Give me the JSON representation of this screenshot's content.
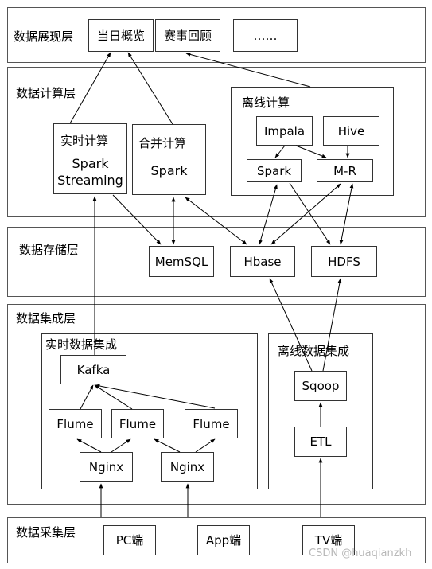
{
  "layers": {
    "presentation": {
      "label": "数据展现层",
      "items": [
        "当日概览",
        "赛事回顾",
        "……"
      ]
    },
    "compute": {
      "label": "数据计算层",
      "realtime": {
        "title": "实时计算",
        "body": [
          "Spark",
          "Streaming"
        ]
      },
      "merge": {
        "title": "合并计算",
        "body": "Spark"
      },
      "offline": {
        "title": "离线计算",
        "impala": "Impala",
        "hive": "Hive",
        "spark": "Spark",
        "mr": "M-R"
      }
    },
    "storage": {
      "label": "数据存储层",
      "items": [
        "MemSQL",
        "Hbase",
        "HDFS"
      ]
    },
    "integration": {
      "label": "数据集成层",
      "realtime": {
        "title": "实时数据集成",
        "kafka": "Kafka",
        "flume": [
          "Flume",
          "Flume",
          "Flume"
        ],
        "nginx": [
          "Nginx",
          "Nginx"
        ]
      },
      "offline": {
        "title": "离线数据集成",
        "sqoop": "Sqoop",
        "etl": "ETL"
      }
    },
    "collection": {
      "label": "数据采集层",
      "items": [
        "PC端",
        "App端",
        "TV端"
      ]
    }
  },
  "watermark": "CSDN @huaqianzkh"
}
